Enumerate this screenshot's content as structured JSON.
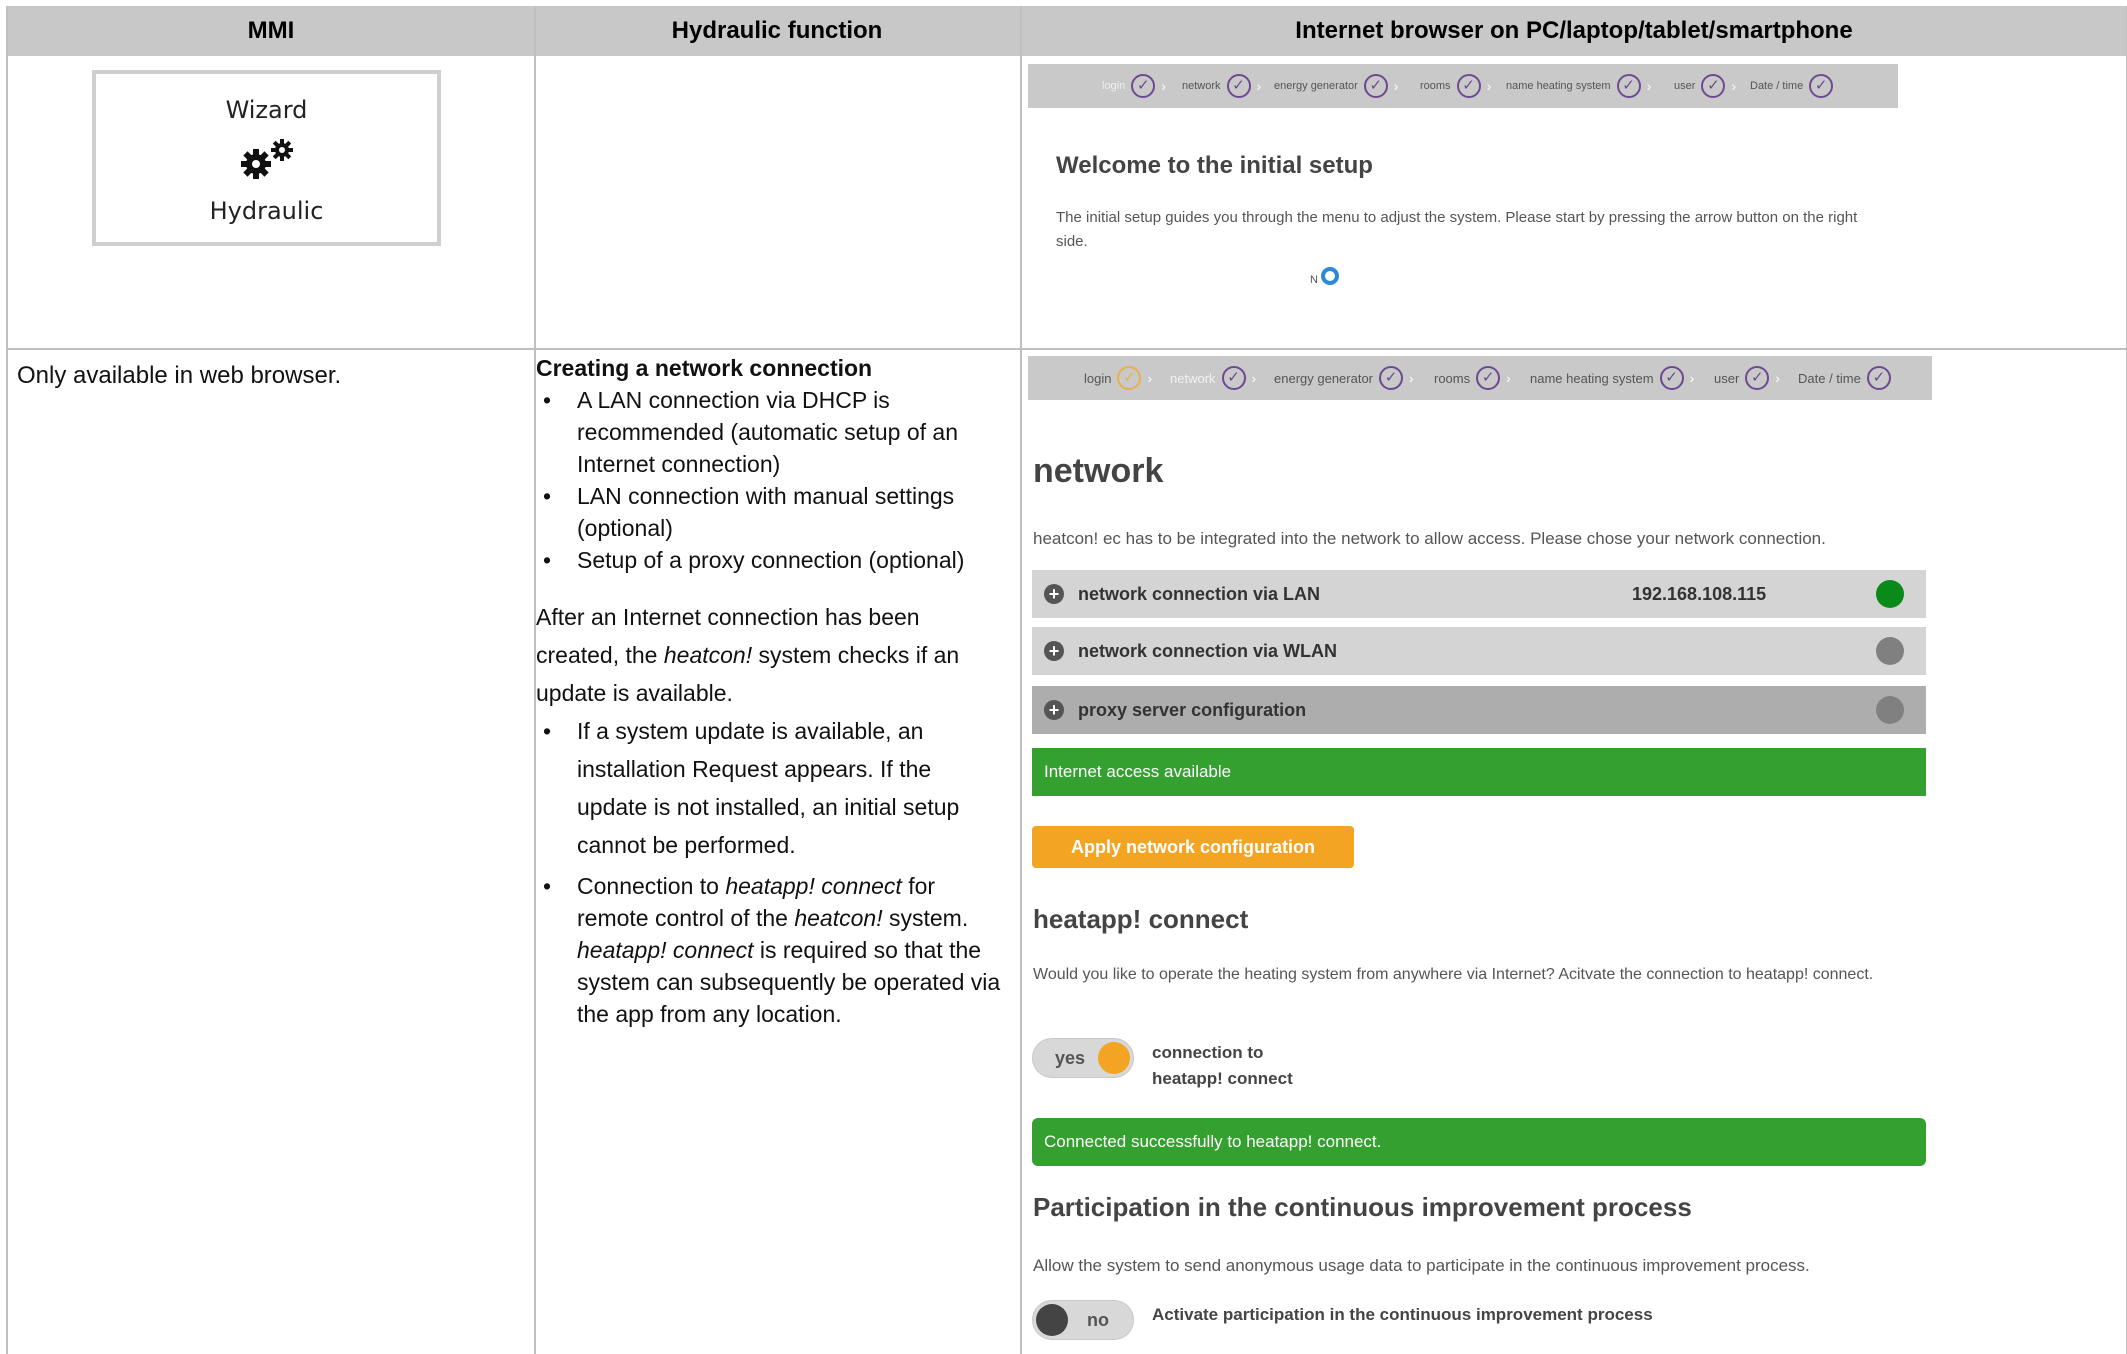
{
  "header": {
    "col1": "MMI",
    "col2": "Hydraulic function",
    "col3": "Internet browser on PC/laptop/tablet/smartphone"
  },
  "mmi_card": {
    "title": "Wizard",
    "icon": "gears-icon",
    "subtitle": "Hydraulic"
  },
  "row1": {
    "stepbar": [
      "login",
      "network",
      "energy generator",
      "rooms",
      "name heating system",
      "user",
      "Date / time"
    ],
    "heading": "Welcome to the initial setup",
    "text": "The initial setup guides you through the menu to adjust the system. Please start by pressing the arrow button on the right side."
  },
  "row2": {
    "mmi_text": "Only available in web browser.",
    "title": "Creating a network connection",
    "bullets1": [
      "A LAN connection via DHCP is recommended (automatic setup of an Internet connection)",
      "LAN connection with manual settings (optional)",
      "Setup of a proxy connection (optional)"
    ],
    "para": "After an Internet connection has been created, the heatcon! system checks if an update is available.",
    "bullet_update": "If a system update is available, an installation Request appears. If the update is not installed, an initial setup cannot be performed.",
    "bullet_connect": "Connection to heatapp! connect for remote control of the heatcon! system. heatapp! connect is required so that the system can subsequently be operated via the app from any location."
  },
  "web": {
    "stepbar": [
      "login",
      "network",
      "energy generator",
      "rooms",
      "name heating system",
      "user",
      "Date / time"
    ],
    "network_title": "network",
    "network_desc": "heatcon! ec has to be integrated into the network to allow access. Please chose your network connection.",
    "lan_label": "network connection via LAN",
    "lan_ip": "192.168.108.115",
    "wlan_label": "network connection via WLAN",
    "proxy_label": "proxy server configuration",
    "internet_status": "Internet access available",
    "apply_button": "Apply network configuration",
    "heatapp_title": "heatapp! connect",
    "heatapp_desc": "Would you like to operate the heating system from anywhere via Internet? Acitvate the connection to heatapp! connect.",
    "toggle_yes": "yes",
    "toggle_yes_caption_1": "connection to",
    "toggle_yes_caption_2": "heatapp! connect",
    "connected_status": "Connected successfully to heatapp! connect.",
    "cip_title": "Participation in the continuous improvement process",
    "cip_desc": "Allow the system to send anonymous usage data to participate in the continuous improvement process.",
    "toggle_no": "no",
    "toggle_no_caption": "Activate participation in the continuous improvement process"
  },
  "colors": {
    "accent": "#f4a423",
    "success": "#34a030",
    "check": "#6d4a91",
    "lan_status": "#0a8a18"
  }
}
